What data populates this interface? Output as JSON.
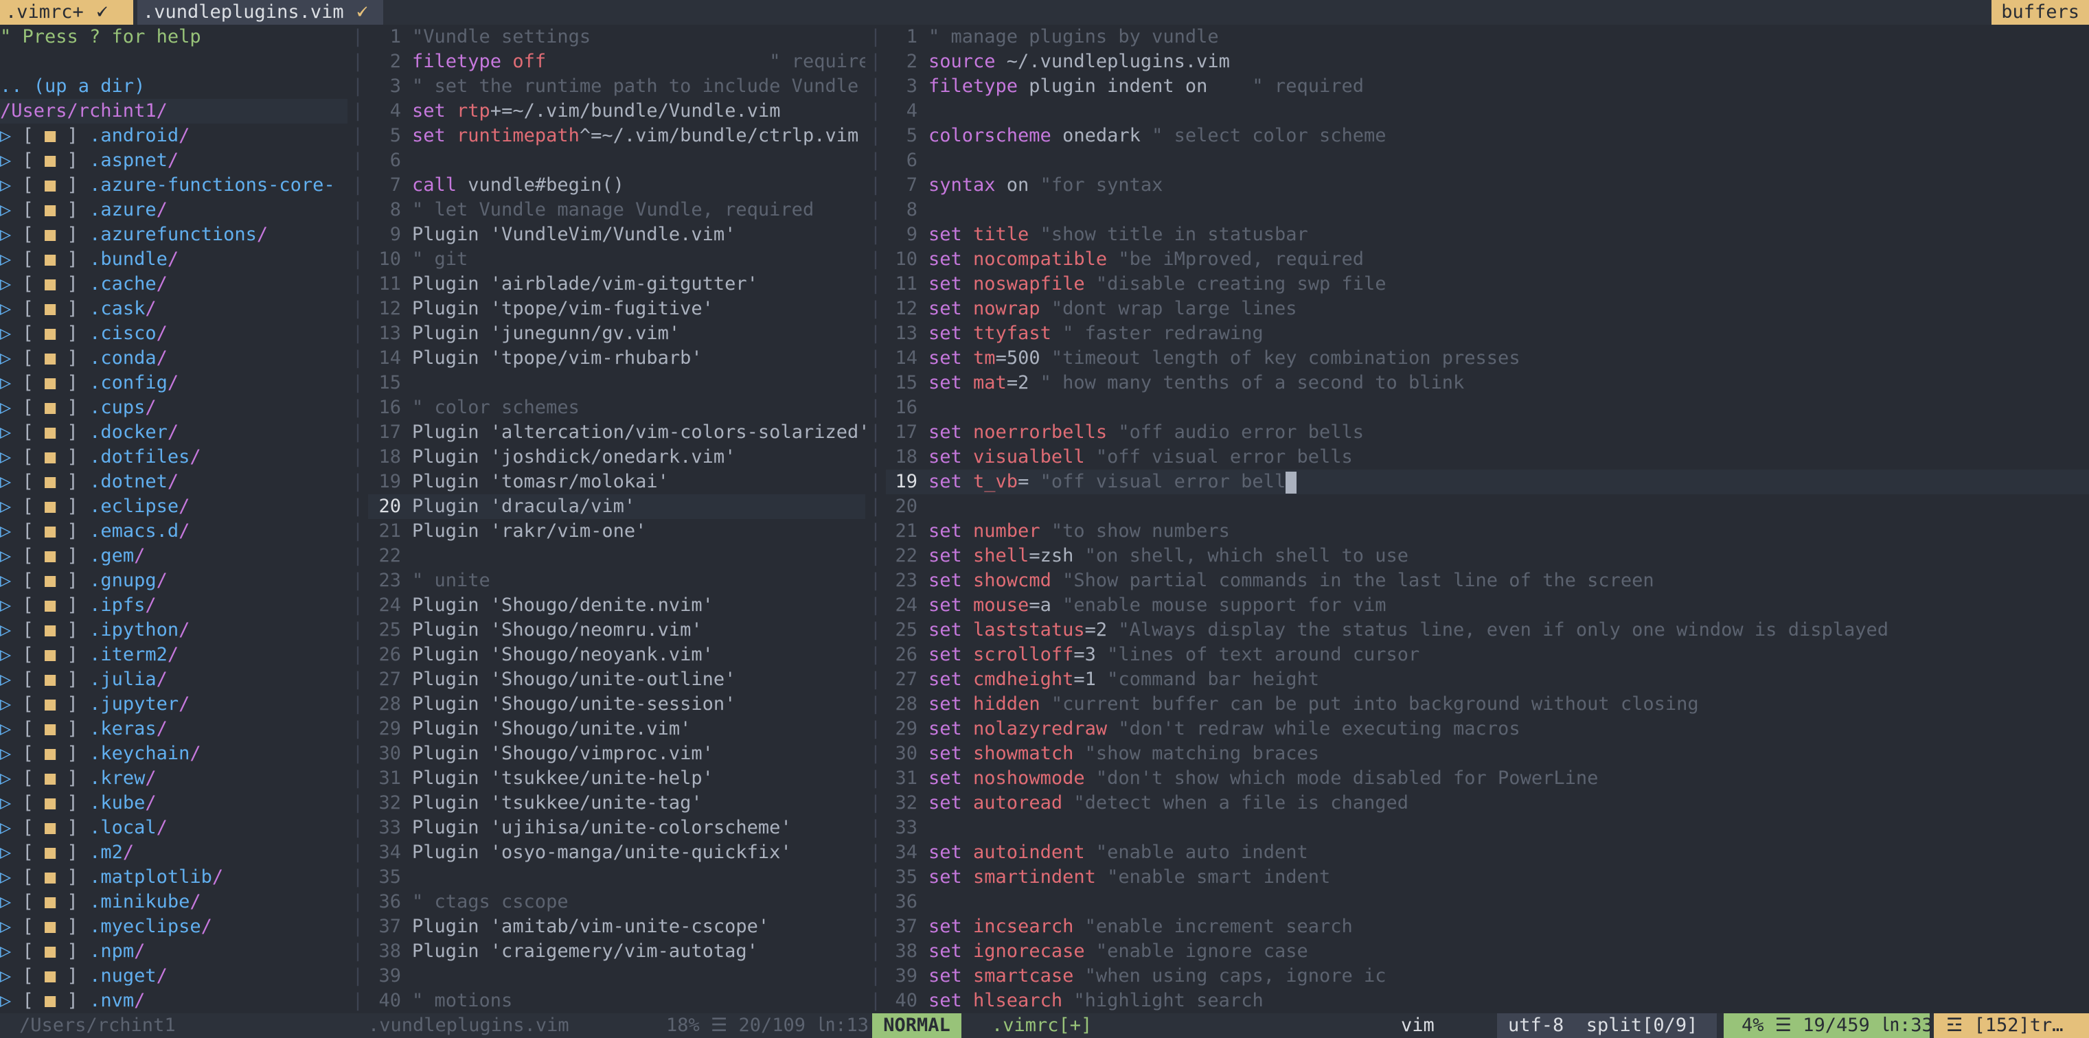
{
  "tabline": {
    "active_tab": ".vimrc+",
    "active_mark": "🗸",
    "inactive_tab": ".vundleplugins.vim",
    "inactive_mark": "🗸",
    "buffers_label": "buffers"
  },
  "tree": {
    "help": "\" Press ? for help",
    "updir": ".. (up a dir)",
    "cwd": "/Users/rchint1/",
    "dirs": [
      ".android",
      ".aspnet",
      ".azure-functions-core-",
      ".azure",
      ".azurefunctions",
      ".bundle",
      ".cache",
      ".cask",
      ".cisco",
      ".conda",
      ".config",
      ".cups",
      ".docker",
      ".dotfiles",
      ".dotnet",
      ".eclipse",
      ".emacs.d",
      ".gem",
      ".gnupg",
      ".ipfs",
      ".ipython",
      ".iterm2",
      ".julia",
      ".jupyter",
      ".keras",
      ".keychain",
      ".krew",
      ".kube",
      ".local",
      ".m2",
      ".matplotlib",
      ".minikube",
      ".myeclipse",
      ".npm",
      ".nuget",
      ".nvm"
    ],
    "truncated": [
      false,
      false,
      true,
      false,
      false,
      false,
      false,
      false,
      false,
      false,
      false,
      false,
      false,
      false,
      false,
      false,
      false,
      false,
      false,
      false,
      false,
      false,
      false,
      false,
      false,
      false,
      false,
      false,
      false,
      false,
      false,
      false,
      false,
      false,
      false,
      false
    ],
    "status": "/Users/rchint1"
  },
  "mid": {
    "lines": [
      {
        "n": "1",
        "c": "\"Vundle settings"
      },
      {
        "n": "2",
        "c": "filetype off                    \" required"
      },
      {
        "n": "3",
        "c": "\" set the runtime path to include Vundle"
      },
      {
        "n": "4",
        "c": "set rtp+=~/.vim/bundle/Vundle.vim"
      },
      {
        "n": "5",
        "c": "set runtimepath^=~/.vim/bundle/ctrlp.vim"
      },
      {
        "n": "6",
        "c": ""
      },
      {
        "n": "7",
        "c": "call vundle#begin()"
      },
      {
        "n": "8",
        "c": "\" let Vundle manage Vundle, required"
      },
      {
        "n": "9",
        "c": "Plugin 'VundleVim/Vundle.vim'"
      },
      {
        "n": "10",
        "c": "\" git"
      },
      {
        "n": "11",
        "c": "Plugin 'airblade/vim-gitgutter'"
      },
      {
        "n": "12",
        "c": "Plugin 'tpope/vim-fugitive'"
      },
      {
        "n": "13",
        "c": "Plugin 'junegunn/gv.vim'"
      },
      {
        "n": "14",
        "c": "Plugin 'tpope/vim-rhubarb'"
      },
      {
        "n": "15",
        "c": ""
      },
      {
        "n": "16",
        "c": "\" color schemes"
      },
      {
        "n": "17",
        "c": "Plugin 'altercation/vim-colors-solarized'"
      },
      {
        "n": "18",
        "c": "Plugin 'joshdick/onedark.vim'"
      },
      {
        "n": "19",
        "c": "Plugin 'tomasr/molokai'"
      },
      {
        "n": "20",
        "c": "Plugin 'dracula/vim'"
      },
      {
        "n": "21",
        "c": "Plugin 'rakr/vim-one'"
      },
      {
        "n": "22",
        "c": ""
      },
      {
        "n": "23",
        "c": "\" unite"
      },
      {
        "n": "24",
        "c": "Plugin 'Shougo/denite.nvim'"
      },
      {
        "n": "25",
        "c": "Plugin 'Shougo/neomru.vim'"
      },
      {
        "n": "26",
        "c": "Plugin 'Shougo/neoyank.vim'"
      },
      {
        "n": "27",
        "c": "Plugin 'Shougo/unite-outline'"
      },
      {
        "n": "28",
        "c": "Plugin 'Shougo/unite-session'"
      },
      {
        "n": "29",
        "c": "Plugin 'Shougo/unite.vim'"
      },
      {
        "n": "30",
        "c": "Plugin 'Shougo/vimproc.vim'"
      },
      {
        "n": "31",
        "c": "Plugin 'tsukkee/unite-help'"
      },
      {
        "n": "32",
        "c": "Plugin 'tsukkee/unite-tag'"
      },
      {
        "n": "33",
        "c": "Plugin 'ujihisa/unite-colorscheme'"
      },
      {
        "n": "34",
        "c": "Plugin 'osyo-manga/unite-quickfix'"
      },
      {
        "n": "35",
        "c": ""
      },
      {
        "n": "36",
        "c": "\" ctags cscope"
      },
      {
        "n": "37",
        "c": "Plugin 'amitab/vim-unite-cscope'"
      },
      {
        "n": "38",
        "c": "Plugin 'craigemery/vim-autotag'"
      },
      {
        "n": "39",
        "c": ""
      },
      {
        "n": "40",
        "c": "\" motions"
      }
    ],
    "cursor_line": "20",
    "status_file": ".vundleplugins.vim",
    "status_pos": "18% ☰ 20/109 ㏑:13"
  },
  "right": {
    "lines": [
      {
        "n": "1",
        "k": "",
        "o": "",
        "v": "",
        "c": "\" manage plugins by vundle"
      },
      {
        "n": "2",
        "k": "source",
        "o": "",
        "v": " ~/.vundleplugins.vim",
        "c": ""
      },
      {
        "n": "3",
        "k": "filetype",
        "o": "",
        "v": " plugin indent on    ",
        "c": "\" required"
      },
      {
        "n": "4",
        "k": "",
        "o": "",
        "v": "",
        "c": ""
      },
      {
        "n": "5",
        "k": "colorscheme",
        "o": "",
        "v": " onedark ",
        "c": "\" select color scheme"
      },
      {
        "n": "6",
        "k": "",
        "o": "",
        "v": "",
        "c": ""
      },
      {
        "n": "7",
        "k": "syntax",
        "o": "",
        "v": " on ",
        "c": "\"for syntax"
      },
      {
        "n": "8",
        "k": "",
        "o": "",
        "v": "",
        "c": ""
      },
      {
        "n": "9",
        "k": "set",
        "o": " title",
        "v": " ",
        "c": "\"show title in statusbar"
      },
      {
        "n": "10",
        "k": "set",
        "o": " nocompatible",
        "v": " ",
        "c": "\"be iMproved, required"
      },
      {
        "n": "11",
        "k": "set",
        "o": " noswapfile",
        "v": " ",
        "c": "\"disable creating swp file"
      },
      {
        "n": "12",
        "k": "set",
        "o": " nowrap",
        "v": " ",
        "c": "\"dont wrap large lines"
      },
      {
        "n": "13",
        "k": "set",
        "o": " ttyfast",
        "v": " ",
        "c": "\" faster redrawing"
      },
      {
        "n": "14",
        "k": "set",
        "o": " tm",
        "v": "=500 ",
        "c": "\"timeout length of key combination presses"
      },
      {
        "n": "15",
        "k": "set",
        "o": " mat",
        "v": "=2 ",
        "c": "\" how many tenths of a second to blink"
      },
      {
        "n": "16",
        "k": "",
        "o": "",
        "v": "",
        "c": ""
      },
      {
        "n": "17",
        "k": "set",
        "o": " noerrorbells",
        "v": " ",
        "c": "\"off audio error bells"
      },
      {
        "n": "18",
        "k": "set",
        "o": " visualbell",
        "v": " ",
        "c": "\"off visual error bells"
      },
      {
        "n": "19",
        "k": "set",
        "o": " t_vb",
        "v": "= ",
        "c": "\"off visual error bell"
      },
      {
        "n": "20",
        "k": "",
        "o": "",
        "v": "",
        "c": ""
      },
      {
        "n": "21",
        "k": "set",
        "o": " number",
        "v": " ",
        "c": "\"to show numbers"
      },
      {
        "n": "22",
        "k": "set",
        "o": " shell",
        "v": "=zsh ",
        "c": "\"on shell, which shell to use"
      },
      {
        "n": "23",
        "k": "set",
        "o": " showcmd",
        "v": " ",
        "c": "\"Show partial commands in the last line of the screen"
      },
      {
        "n": "24",
        "k": "set",
        "o": " mouse",
        "v": "=a ",
        "c": "\"enable mouse support for vim"
      },
      {
        "n": "25",
        "k": "set",
        "o": " laststatus",
        "v": "=2 ",
        "c": "\"Always display the status line, even if only one window is displayed"
      },
      {
        "n": "26",
        "k": "set",
        "o": " scrolloff",
        "v": "=3 ",
        "c": "\"lines of text around cursor"
      },
      {
        "n": "27",
        "k": "set",
        "o": " cmdheight",
        "v": "=1 ",
        "c": "\"command bar height"
      },
      {
        "n": "28",
        "k": "set",
        "o": " hidden",
        "v": " ",
        "c": "\"current buffer can be put into background without closing"
      },
      {
        "n": "29",
        "k": "set",
        "o": " nolazyredraw",
        "v": " ",
        "c": "\"don't redraw while executing macros"
      },
      {
        "n": "30",
        "k": "set",
        "o": " showmatch",
        "v": " ",
        "c": "\"show matching braces"
      },
      {
        "n": "31",
        "k": "set",
        "o": " noshowmode",
        "v": " ",
        "c": "\"don't show which mode disabled for PowerLine"
      },
      {
        "n": "32",
        "k": "set",
        "o": " autoread",
        "v": " ",
        "c": "\"detect when a file is changed"
      },
      {
        "n": "33",
        "k": "",
        "o": "",
        "v": "",
        "c": ""
      },
      {
        "n": "34",
        "k": "set",
        "o": " autoindent",
        "v": " ",
        "c": "\"enable auto indent"
      },
      {
        "n": "35",
        "k": "set",
        "o": " smartindent",
        "v": " ",
        "c": "\"enable smart indent"
      },
      {
        "n": "36",
        "k": "",
        "o": "",
        "v": "",
        "c": ""
      },
      {
        "n": "37",
        "k": "set",
        "o": " incsearch",
        "v": " ",
        "c": "\"enable increment search"
      },
      {
        "n": "38",
        "k": "set",
        "o": " ignorecase",
        "v": " ",
        "c": "\"enable ignore case"
      },
      {
        "n": "39",
        "k": "set",
        "o": " smartcase",
        "v": " ",
        "c": "\"when using caps, ignore ic"
      },
      {
        "n": "40",
        "k": "set",
        "o": " hlsearch",
        "v": " ",
        "c": "\"highlight search"
      }
    ],
    "cursor_line": "19"
  },
  "statusline": {
    "mode": "NORMAL",
    "file": ".vimrc[+]",
    "filetype": "vim ",
    "filetype_icon": "",
    "encoding": "utf-8  split[0/9]",
    "position": "4% ☰ 19/459 ㏑:33",
    "warning": "☲ [152]tr…"
  },
  "colors": {
    "background": "#282c34",
    "mode_normal": "#98c379",
    "tab_active": "#e5c07b",
    "keyword": "#c678dd",
    "option": "#e06c75",
    "comment": "#5c6370",
    "directory": "#61afef"
  }
}
